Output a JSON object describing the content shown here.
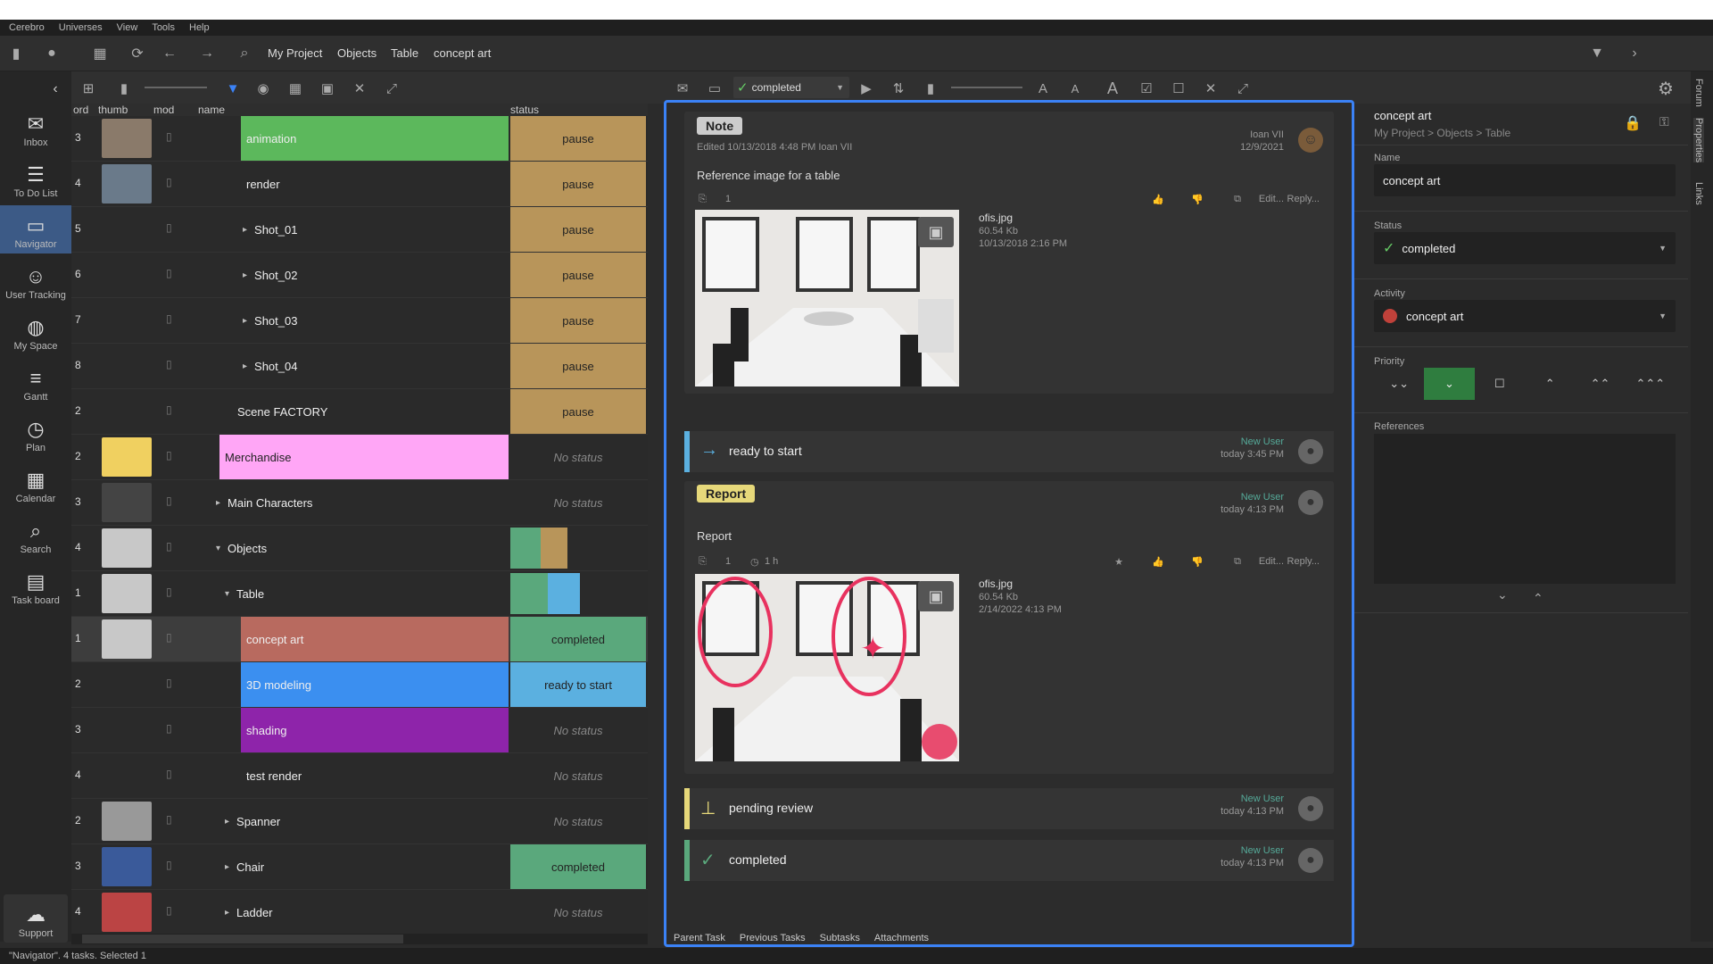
{
  "menu": [
    "Cerebro",
    "Universes",
    "View",
    "Tools",
    "Help"
  ],
  "breadcrumb": [
    "My Project",
    "Objects",
    "Table",
    "concept art"
  ],
  "sidebar": [
    {
      "label": "Inbox",
      "icon": "envelope-icon"
    },
    {
      "label": "To Do List",
      "icon": "list-icon"
    },
    {
      "label": "Navigator",
      "icon": "folder-icon"
    },
    {
      "label": "User Tracking",
      "icon": "users-icon"
    },
    {
      "label": "My Space",
      "icon": "globe-icon"
    },
    {
      "label": "Gantt",
      "icon": "gantt-icon"
    },
    {
      "label": "Plan",
      "icon": "plan-icon"
    },
    {
      "label": "Calendar",
      "icon": "calendar-icon"
    },
    {
      "label": "Search",
      "icon": "search-icon"
    },
    {
      "label": "Task board",
      "icon": "clipboard-icon"
    }
  ],
  "support_label": "Support",
  "toolbar2": {
    "status_value": "completed"
  },
  "table": {
    "headers": {
      "ord": "ord",
      "thumb": "thumb",
      "mod": "mod",
      "name": "name",
      "status": "status"
    },
    "rows": [
      {
        "ord": "3",
        "name": "animation",
        "status": "pause",
        "name_color": "#5cb85c",
        "status_color": "#b8955a",
        "indent": 0
      },
      {
        "ord": "4",
        "name": "render",
        "status": "pause",
        "name_color": "",
        "status_color": "#b8955a",
        "indent": 0
      },
      {
        "ord": "5",
        "name": "Shot_01",
        "status": "pause",
        "name_color": "",
        "status_color": "#b8955a",
        "indent": 1
      },
      {
        "ord": "6",
        "name": "Shot_02",
        "status": "pause",
        "name_color": "",
        "status_color": "#b8955a",
        "indent": 1
      },
      {
        "ord": "7",
        "name": "Shot_03",
        "status": "pause",
        "name_color": "",
        "status_color": "#b8955a",
        "indent": 1
      },
      {
        "ord": "8",
        "name": "Shot_04",
        "status": "pause",
        "name_color": "",
        "status_color": "#b8955a",
        "indent": 1
      },
      {
        "ord": "2",
        "name": "Scene FACTORY",
        "status": "pause",
        "name_color": "",
        "status_color": "#b8955a",
        "indent": 0
      },
      {
        "ord": "2",
        "name": "Merchandise",
        "status": "No status",
        "name_color": "#ffa6f6",
        "status_color": "",
        "indent": 0
      },
      {
        "ord": "3",
        "name": "Main Characters",
        "status": "No status",
        "name_color": "",
        "status_color": "",
        "indent": 1
      },
      {
        "ord": "4",
        "name": "Objects",
        "status": "",
        "name_color": "",
        "status_color": "",
        "indent": 1
      },
      {
        "ord": "1",
        "name": "Table",
        "status": "",
        "name_color": "",
        "status_color": "",
        "indent": 2
      },
      {
        "ord": "1",
        "name": "concept art",
        "status": "completed",
        "name_color": "#b86a5f",
        "status_color": "#5aa87c",
        "indent": 0
      },
      {
        "ord": "2",
        "name": "3D modeling",
        "status": "ready to start",
        "name_color": "#3b8ff0",
        "status_color": "#5bb0e0",
        "indent": 0
      },
      {
        "ord": "3",
        "name": "shading",
        "status": "No status",
        "name_color": "#8e24aa",
        "status_color": "",
        "indent": 0
      },
      {
        "ord": "4",
        "name": "test render",
        "status": "No status",
        "name_color": "",
        "status_color": "",
        "indent": 0
      },
      {
        "ord": "2",
        "name": "Spanner",
        "status": "No status",
        "name_color": "",
        "status_color": "",
        "indent": 2
      },
      {
        "ord": "3",
        "name": "Chair",
        "status": "completed",
        "name_color": "",
        "status_color": "#5aa87c",
        "indent": 2
      },
      {
        "ord": "4",
        "name": "Ladder",
        "status": "No status",
        "name_color": "",
        "status_color": "",
        "indent": 2
      }
    ]
  },
  "feed": {
    "note": {
      "tag": "Note",
      "edited": "Edited 10/13/2018 4:48 PM   Ioan VII",
      "author": "Ioan VII",
      "date": "12/9/2021",
      "text": "Reference image for a table",
      "count": "1",
      "edit": "Edit...",
      "reply": "Reply...",
      "file": "ofis.jpg",
      "size": "60.54 Kb",
      "file_date": "10/13/2018 2:16 PM"
    },
    "evt1": {
      "label": "ready to start",
      "who": "New User",
      "when": "today 3:45 PM"
    },
    "report": {
      "tag": "Report",
      "who": "New User",
      "when": "today 4:13 PM",
      "text": "Report",
      "count": "1",
      "time": "1 h",
      "edit": "Edit...",
      "reply": "Reply...",
      "file": "ofis.jpg",
      "size": "60.54 Kb",
      "file_date": "2/14/2022 4:13 PM"
    },
    "evt2": {
      "label": "pending review",
      "who": "New User",
      "when": "today 4:13 PM"
    },
    "evt3": {
      "label": "completed",
      "who": "New User",
      "when": "today 4:13 PM"
    },
    "tabs": [
      "Parent Task",
      "Previous Tasks",
      "Subtasks",
      "Attachments"
    ]
  },
  "right": {
    "title": "concept art",
    "path": "My Project > Objects > Table",
    "name_label": "Name",
    "name_value": "concept art",
    "status_label": "Status",
    "status_value": "completed",
    "activity_label": "Activity",
    "activity_value": "concept art",
    "priority_label": "Priority",
    "references_label": "References"
  },
  "vtabs": [
    "Forum",
    "Properties",
    "Links"
  ],
  "statusbar": "\"Navigator\". 4 tasks. Selected 1",
  "colors": {
    "accent": "#3b82f6",
    "selected_nav": "#3c5a86",
    "completed": "#5aa87c",
    "pause": "#b8955a"
  }
}
